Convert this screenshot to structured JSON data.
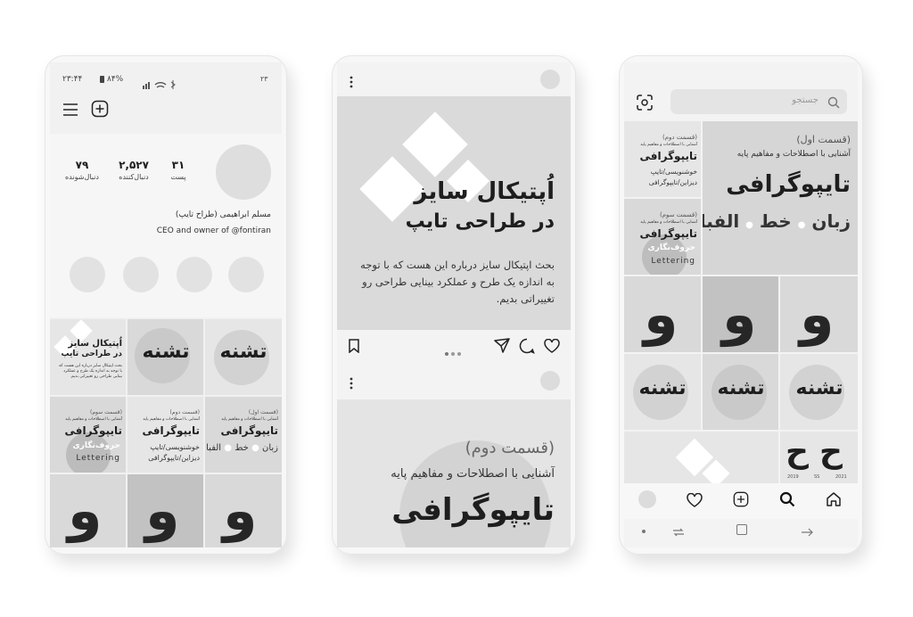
{
  "phone_left": {
    "status": {
      "time": "۲۳:۴۴",
      "battery": "۸۴%",
      "right_text": "۲۳"
    },
    "profile": {
      "stats": [
        {
          "value": "۷۹",
          "label": "دنبال‌شونده"
        },
        {
          "value": "۲,۵۲۷",
          "label": "دنبال‌کننده"
        },
        {
          "value": "۳۱",
          "label": "پست"
        }
      ],
      "name": "مسلم ابراهیمی (طراح تایپ)",
      "bio": "CEO and owner of @fontiran"
    },
    "grid": {
      "optical_title_1": "اُپتیکال سایز",
      "optical_title_2": "در طراحی تایپ",
      "optical_body": "بحث اپتیکال سایز درباره این هست که با توجه به اندازه یک طرح و عملکرد بینایی طراحی رو تغییراتی بدیم.",
      "tashne": "تشنه",
      "part3": "(قسمت سوم)",
      "part2": "(قسمت دوم)",
      "part1": "(قسمت اول)",
      "subtitle": "آشنایی با اصطلاحات و مفاهیم پایه",
      "typography": "تایپوگرافی",
      "huruf": "حروف‌نگاری",
      "lettering": "Lettering",
      "khoshnevisi_1": "خوشنویسی/تایپ",
      "khoshnevisi_2": "دیزاین/تایپوگرافی",
      "zaban": "زبان",
      "khat": "خط",
      "alefba": "الفبا",
      "waw": "و"
    }
  },
  "phone_middle": {
    "post1": {
      "title_1": "اُپتیکال سایز",
      "title_2": "در طراحی تایپ",
      "body": "بحث اپتیکال سایز درباره این هست که با توجه به اندازه یک طرح و عملکرد بینایی طراحی رو تغییراتی بدیم."
    },
    "post2": {
      "part": "(قسمت دوم)",
      "subtitle": "آشنایی با اصطلاحات و مفاهیم پایه",
      "title": "تایپوگرافی"
    }
  },
  "phone_right": {
    "search": {
      "placeholder": "جستجو"
    },
    "grid": {
      "part1": "(قسمت اول)",
      "part2": "(قسمت دوم)",
      "part3": "(قسمت سوم)",
      "subtitle": "آشنایی با اصطلاحات و مفاهیم پایه",
      "typography": "تایپوگرافی",
      "zaban": "زبان",
      "khat": "خط",
      "alefba": "الفبا",
      "khoshnevisi_1": "خوشنویسی/تایپ",
      "khoshnevisi_2": "دیزاین/تایپوگرافی",
      "huruf": "حروف‌نگاری",
      "lettering": "Lettering",
      "waw": "و",
      "tashne": "تشنه",
      "he": "ح",
      "year_1": "2019",
      "year_2": "SS",
      "year_3": "2021"
    }
  }
}
